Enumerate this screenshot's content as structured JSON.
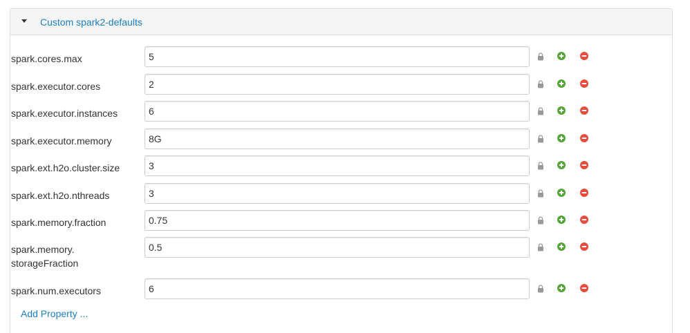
{
  "panel": {
    "title": "Custom spark2-defaults"
  },
  "properties": [
    {
      "name": "spark.cores.max",
      "value": "5"
    },
    {
      "name": "spark.executor.cores",
      "value": "2"
    },
    {
      "name": "spark.executor.instances",
      "value": "6"
    },
    {
      "name": "spark.executor.memory",
      "value": "8G"
    },
    {
      "name": "spark.ext.h2o.cluster.size",
      "value": "3"
    },
    {
      "name": "spark.ext.h2o.nthreads",
      "value": "3"
    },
    {
      "name": "spark.memory.fraction",
      "value": "0.75"
    },
    {
      "name": "spark.memory.\nstorageFraction",
      "value": "0.5"
    },
    {
      "name": "spark.num.executors",
      "value": "6"
    }
  ],
  "footer": {
    "add_property_label": "Add Property ..."
  },
  "colors": {
    "link": "#1b7fc1",
    "add": "#52a435",
    "remove": "#e74c3c",
    "lock": "#999999"
  },
  "icons": [
    "caret-down-icon",
    "lock-icon",
    "plus-circle-icon",
    "minus-circle-icon"
  ]
}
